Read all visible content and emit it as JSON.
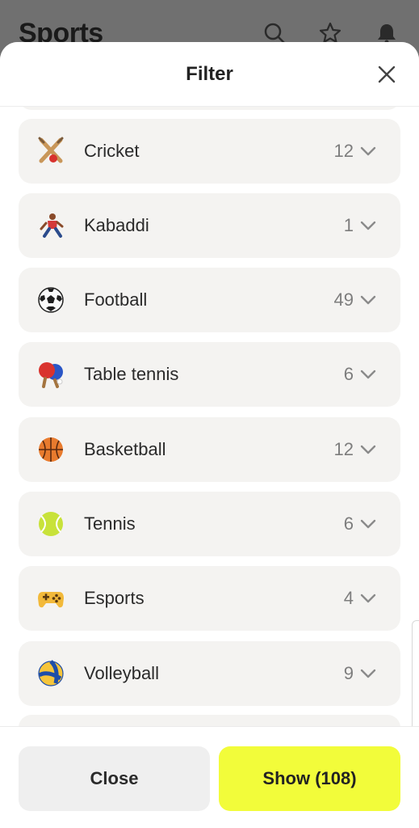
{
  "appbar": {
    "title": "Sports",
    "icons": [
      "search-icon",
      "star-icon",
      "bell-icon"
    ]
  },
  "sheet": {
    "title": "Filter",
    "close_icon": "close-icon"
  },
  "sports": [
    {
      "label": "Cricket",
      "count": "12",
      "icon": "cricket-icon"
    },
    {
      "label": "Kabaddi",
      "count": "1",
      "icon": "kabaddi-icon"
    },
    {
      "label": "Football",
      "count": "49",
      "icon": "football-icon"
    },
    {
      "label": "Table tennis",
      "count": "6",
      "icon": "table-tennis-icon"
    },
    {
      "label": "Basketball",
      "count": "12",
      "icon": "basketball-icon"
    },
    {
      "label": "Tennis",
      "count": "6",
      "icon": "tennis-icon"
    },
    {
      "label": "Esports",
      "count": "4",
      "icon": "esports-icon"
    },
    {
      "label": "Volleyball",
      "count": "9",
      "icon": "volleyball-icon"
    }
  ],
  "footer": {
    "close_label": "Close",
    "show_label": "Show (108)"
  },
  "colors": {
    "accent": "#f2fc3a",
    "row_bg": "#f4f3f1",
    "close_bg": "#efefef"
  }
}
